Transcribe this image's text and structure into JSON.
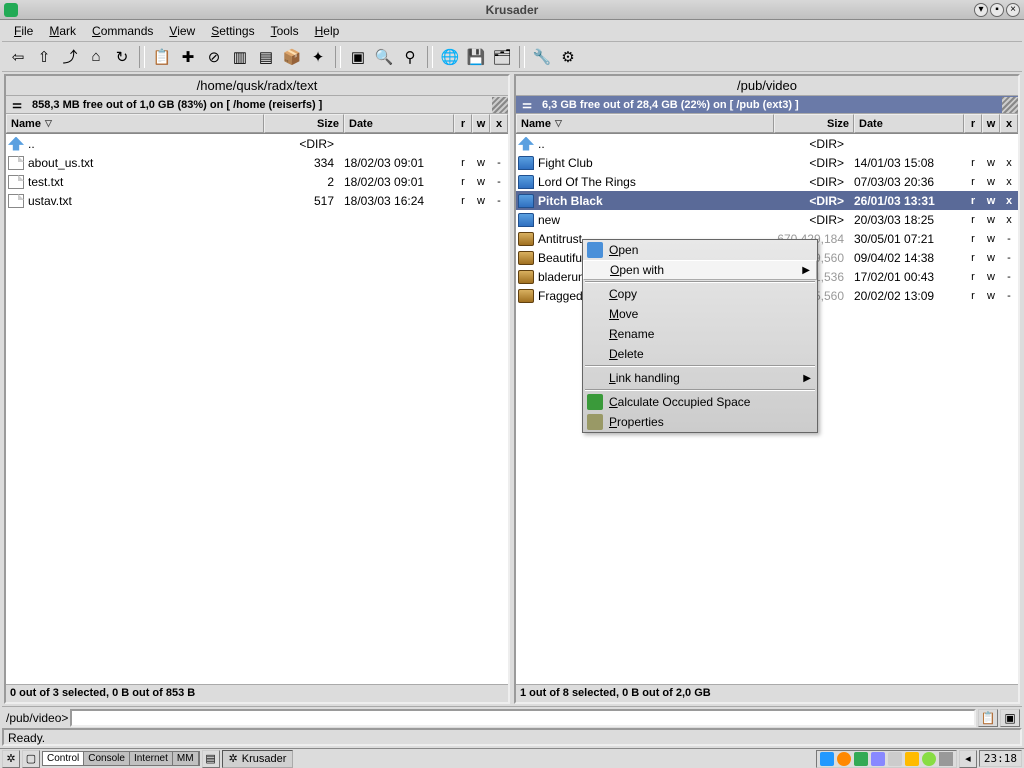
{
  "app_title": "Krusader",
  "menus": [
    "File",
    "Mark",
    "Commands",
    "View",
    "Settings",
    "Tools",
    "Help"
  ],
  "toolbar_icons": [
    "back",
    "up",
    "up-alt",
    "home",
    "refresh",
    "sep",
    "paste",
    "new",
    "delete",
    "split-h",
    "split-v",
    "compress",
    "wand",
    "sep",
    "select",
    "zoom",
    "find",
    "sep",
    "globe",
    "disk",
    "folder-tree",
    "sep",
    "tools",
    "prefs"
  ],
  "left": {
    "path": "/home/qusk/radx/text",
    "info": "858,3 MB free out of 1,0 GB (83%) on [ /home (reiserfs) ]",
    "active": false,
    "columns": [
      "Name",
      "Size",
      "Date",
      "r",
      "w",
      "x"
    ],
    "rows": [
      {
        "icon": "up",
        "name": "..",
        "size": "<DIR>",
        "date": "",
        "r": "",
        "w": "",
        "x": ""
      },
      {
        "icon": "file",
        "name": "about_us.txt",
        "size": "334",
        "date": "18/02/03 09:01",
        "r": "r",
        "w": "w",
        "x": "-"
      },
      {
        "icon": "file",
        "name": "test.txt",
        "size": "2",
        "date": "18/02/03 09:01",
        "r": "r",
        "w": "w",
        "x": "-"
      },
      {
        "icon": "file",
        "name": "ustav.txt",
        "size": "517",
        "date": "18/03/03 16:24",
        "r": "r",
        "w": "w",
        "x": "-"
      }
    ],
    "status": "0 out of 3 selected, 0 B out of 853 B"
  },
  "right": {
    "path": "/pub/video",
    "info": "6,3 GB free out of 28,4 GB (22%) on [ /pub (ext3) ]",
    "active": true,
    "columns": [
      "Name",
      "Size",
      "Date",
      "r",
      "w",
      "x"
    ],
    "rows": [
      {
        "icon": "up",
        "name": "..",
        "size": "<DIR>",
        "date": "",
        "r": "",
        "w": "",
        "x": ""
      },
      {
        "icon": "folder",
        "name": "Fight Club",
        "size": "<DIR>",
        "date": "14/01/03 15:08",
        "r": "r",
        "w": "w",
        "x": "x"
      },
      {
        "icon": "folder",
        "name": "Lord Of The Rings",
        "size": "<DIR>",
        "date": "07/03/03 20:36",
        "r": "r",
        "w": "w",
        "x": "x"
      },
      {
        "icon": "folder",
        "name": "Pitch Black",
        "size": "<DIR>",
        "date": "26/01/03 13:31",
        "r": "r",
        "w": "w",
        "x": "x",
        "selected": true
      },
      {
        "icon": "folder",
        "name": "new",
        "size": "<DIR>",
        "date": "20/03/03 18:25",
        "r": "r",
        "w": "w",
        "x": "x"
      },
      {
        "icon": "compress",
        "name": "Antitrust",
        "size": "670,429,184",
        "date": "30/05/01 07:21",
        "r": "r",
        "w": "w",
        "x": "-",
        "dim": true
      },
      {
        "icon": "compress",
        "name": "Beautiful Mind",
        "size": "732,639,560",
        "date": "09/04/02 14:38",
        "r": "r",
        "w": "w",
        "x": "-",
        "dim": true
      },
      {
        "icon": "compress",
        "name": "bladerunner",
        "size": "705,601,536",
        "date": "17/02/01 00:43",
        "r": "r",
        "w": "w",
        "x": "-",
        "dim": true
      },
      {
        "icon": "compress",
        "name": "Fraggedbbl",
        "size": "75,265,560",
        "date": "20/02/02 13:09",
        "r": "r",
        "w": "w",
        "x": "-",
        "dim": true
      }
    ],
    "status": "1 out of 8 selected, 0 B out of 2,0 GB"
  },
  "context_menu": [
    {
      "label": "Open",
      "icon": "folder"
    },
    {
      "label": "Open with",
      "submenu": true,
      "highlight": true
    },
    {
      "sep": true
    },
    {
      "label": "Copy"
    },
    {
      "label": "Move"
    },
    {
      "label": "Rename"
    },
    {
      "label": "Delete"
    },
    {
      "sep": true
    },
    {
      "label": "Link handling",
      "submenu": true
    },
    {
      "sep": true
    },
    {
      "label": "Calculate Occupied Space",
      "icon": "disk"
    },
    {
      "label": "Properties",
      "icon": "props"
    }
  ],
  "cmd_prompt": "/pub/video>",
  "ready": "Ready.",
  "taskbar": {
    "pager": [
      "Control",
      "Console",
      "Internet",
      "MM"
    ],
    "pager_active": 0,
    "task": "Krusader",
    "clock": "23:18"
  }
}
